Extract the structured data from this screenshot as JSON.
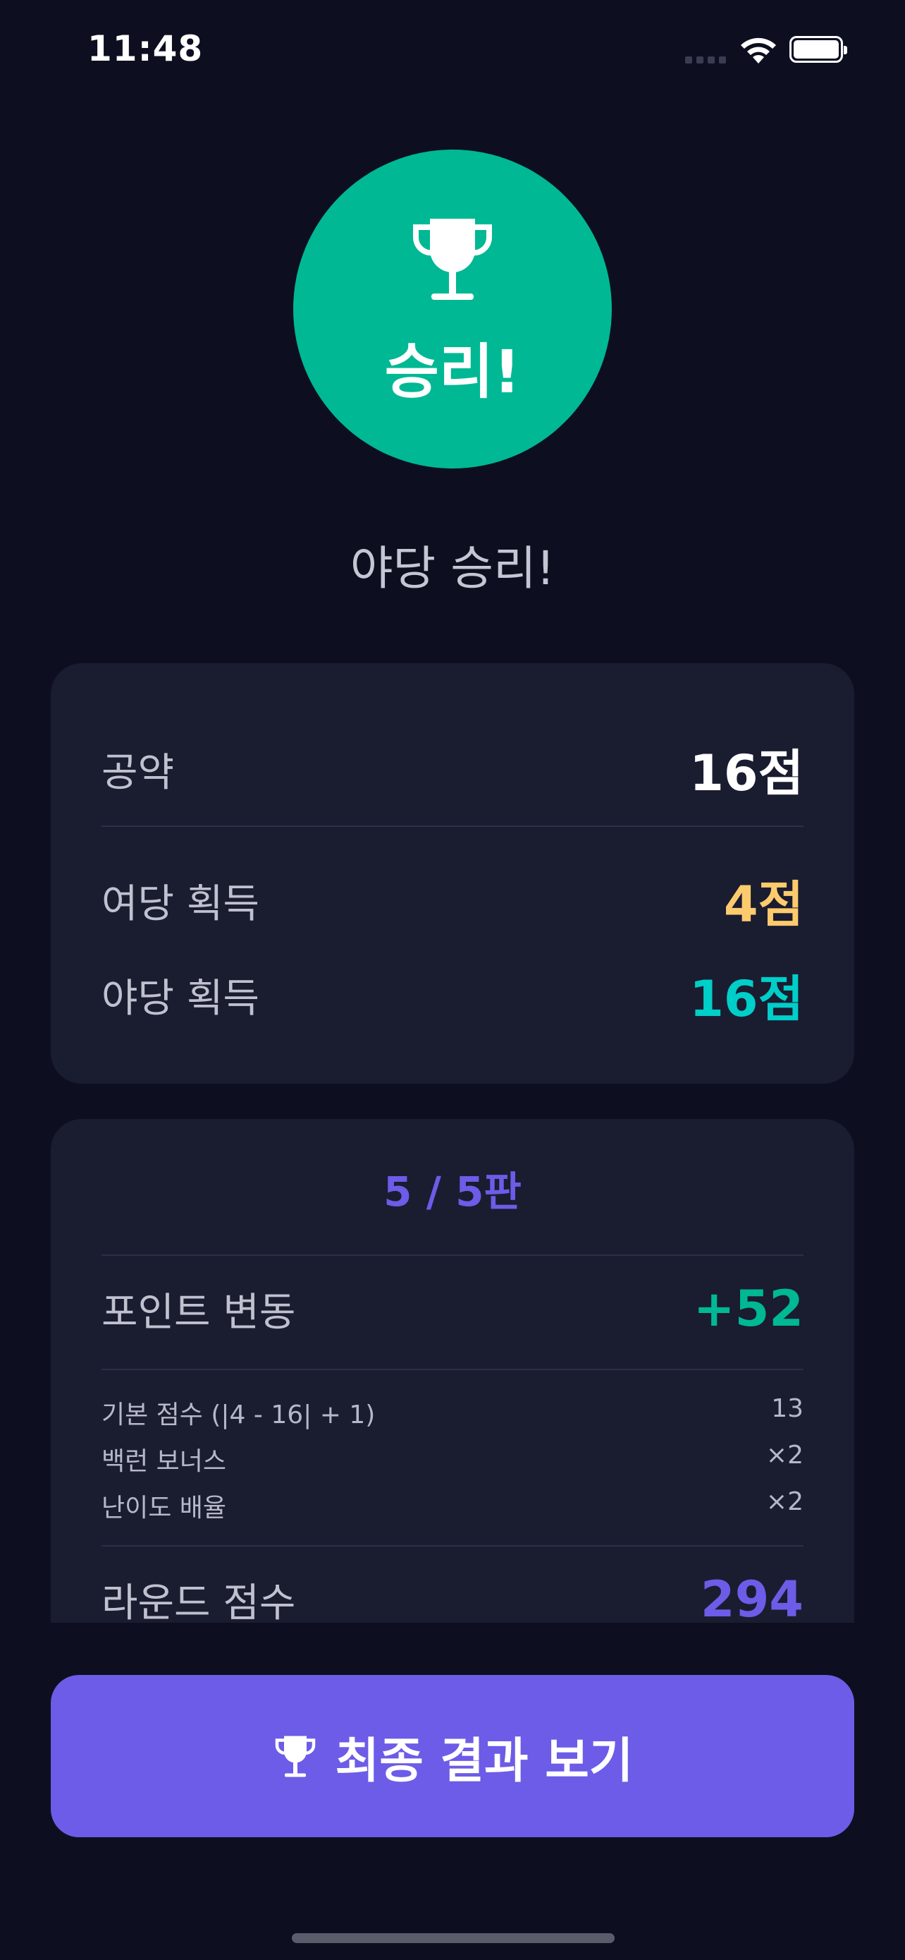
{
  "status_bar": {
    "time": "11:48"
  },
  "hero": {
    "label": "승리!",
    "icon": "trophy-icon",
    "color": "#00b894"
  },
  "subtitle": "야당 승리!",
  "summary": {
    "pledge": {
      "label": "공약",
      "value": "16점",
      "color": "#ffffff"
    },
    "ruling_gain": {
      "label": "여당 획득",
      "value": "4점",
      "color": "#fdcb6e"
    },
    "opposition_gain": {
      "label": "야당 획득",
      "value": "16점",
      "color": "#00cec9"
    }
  },
  "round": {
    "title": "5 / 5판",
    "point_change": {
      "label": "포인트 변동",
      "value": "+52",
      "color": "#00b894"
    },
    "details": [
      {
        "label": "기본 점수 (|4 - 16| + 1)",
        "value": "13"
      },
      {
        "label": "백런 보너스",
        "value": "×2"
      },
      {
        "label": "난이도 배율",
        "value": "×2"
      }
    ],
    "round_score": {
      "label": "라운드 점수",
      "value": "294",
      "color": "#6c5ce7"
    }
  },
  "cta": {
    "label": "최종 결과 보기",
    "icon": "trophy-icon",
    "color": "#6c5ce7"
  }
}
